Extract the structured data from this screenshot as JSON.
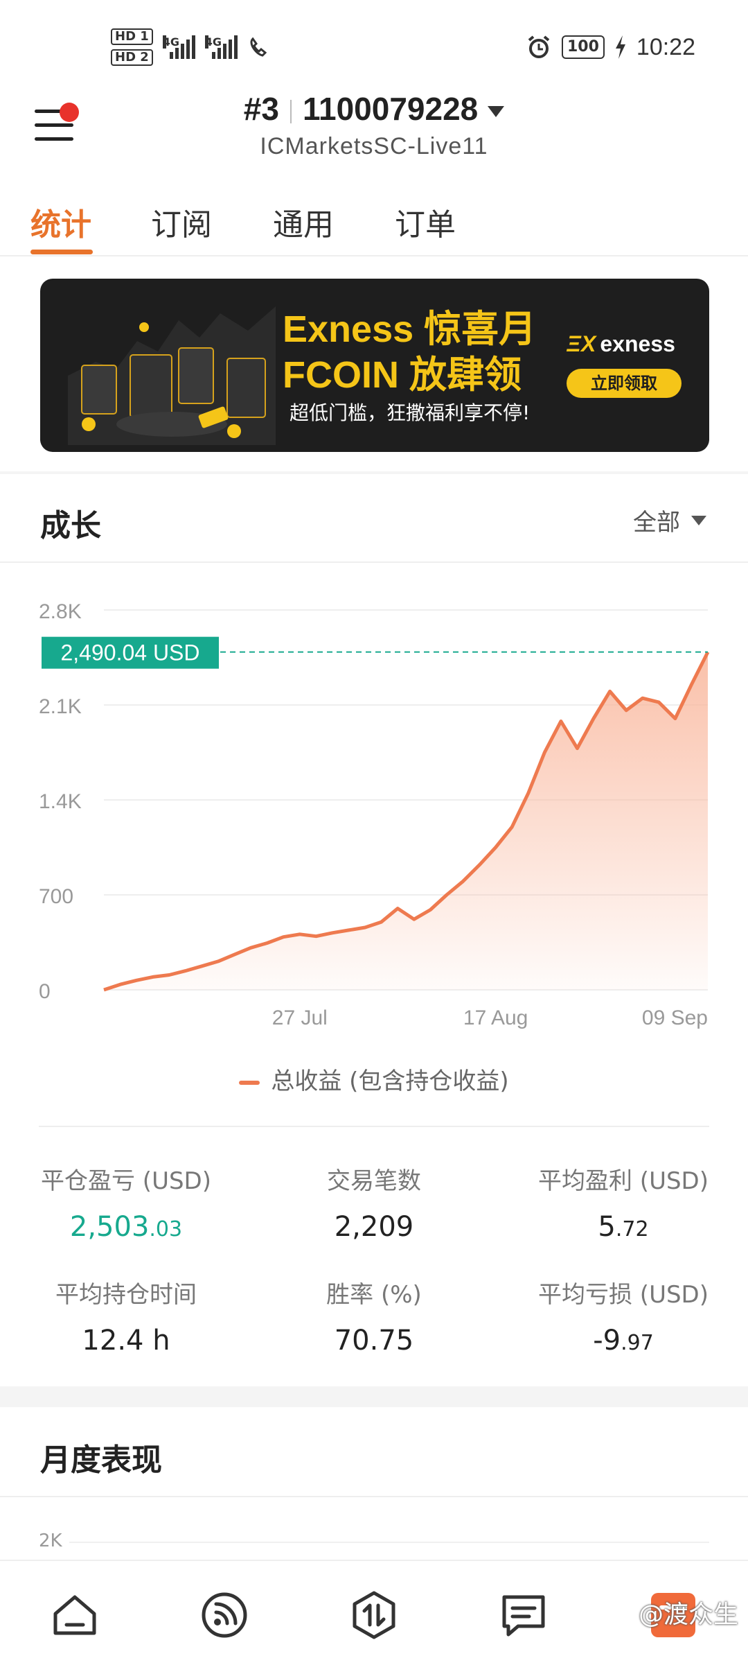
{
  "status_bar": {
    "time": "10:22",
    "battery": "100",
    "sim1": "HD 1",
    "sim2": "HD 2",
    "network": "4G",
    "icons": [
      "signal-icon",
      "wifi-call-icon",
      "alarm-icon",
      "battery-icon",
      "charging-icon"
    ]
  },
  "header": {
    "account_index": "#3",
    "account_number": "1100079228",
    "server": "ICMarketsSC-Live11"
  },
  "tabs": [
    {
      "label": "统计",
      "active": true
    },
    {
      "label": "订阅",
      "active": false
    },
    {
      "label": "通用",
      "active": false
    },
    {
      "label": "订单",
      "active": false
    }
  ],
  "banner": {
    "line1": "Exness 惊喜月",
    "line2": "FCOIN 放肆领",
    "subtitle": "超低门槛，狂撒福利享不停!",
    "brand": "exness",
    "button": "立即领取"
  },
  "growth": {
    "title": "成长",
    "filter": "全部",
    "current_value_label": "2,490.04 USD",
    "legend": "总收益 (包含持仓收益)"
  },
  "chart_data": {
    "type": "area",
    "series": [
      {
        "name": "总收益 (包含持仓收益)",
        "values": [
          0,
          40,
          70,
          95,
          110,
          140,
          175,
          210,
          260,
          310,
          345,
          390,
          410,
          395,
          420,
          440,
          460,
          500,
          600,
          520,
          590,
          700,
          800,
          920,
          1050,
          1200,
          1450,
          1750,
          1980,
          1780,
          2000,
          2200,
          2060,
          2150,
          2120,
          2000,
          2250,
          2490
        ]
      }
    ],
    "x_tick_labels": [
      "27 Jul",
      "17 Aug",
      "09 Sep"
    ],
    "x_tick_index": [
      12,
      24,
      37
    ],
    "y_ticks": [
      0,
      700,
      1400,
      2100,
      2800
    ],
    "y_tick_labels": [
      "0",
      "700",
      "1.4K",
      "2.1K",
      "2.8K"
    ],
    "ylim": [
      0,
      2800
    ],
    "current_value": 2490.04,
    "colors": {
      "line": "#ee7a4f",
      "fill_top": "#f9b59a",
      "marker": "#17a98e"
    }
  },
  "stats": [
    {
      "label": "平仓盈亏 (USD)",
      "value_main": "2,503",
      "value_frac": ".03",
      "color": "green"
    },
    {
      "label": "交易笔数",
      "value_main": "2,209",
      "value_frac": "",
      "color": "default"
    },
    {
      "label": "平均盈利 (USD)",
      "value_main": "5",
      "value_frac": ".72",
      "color": "default"
    },
    {
      "label": "平均持仓时间",
      "value_main": "12.4 h",
      "value_frac": "",
      "color": "default"
    },
    {
      "label": "胜率 (%)",
      "value_main": "70.75",
      "value_frac": "",
      "color": "default"
    },
    {
      "label": "平均亏损 (USD)",
      "value_main": "-9",
      "value_frac": ".97",
      "color": "default"
    }
  ],
  "monthly": {
    "title": "月度表现",
    "first_tick": "2K"
  },
  "bottom_nav": [
    {
      "icon": "home-icon"
    },
    {
      "icon": "signal-feed-icon"
    },
    {
      "icon": "trade-icon"
    },
    {
      "icon": "message-icon"
    },
    {
      "icon": "mine-icon"
    }
  ],
  "watermark": "@渡众生"
}
